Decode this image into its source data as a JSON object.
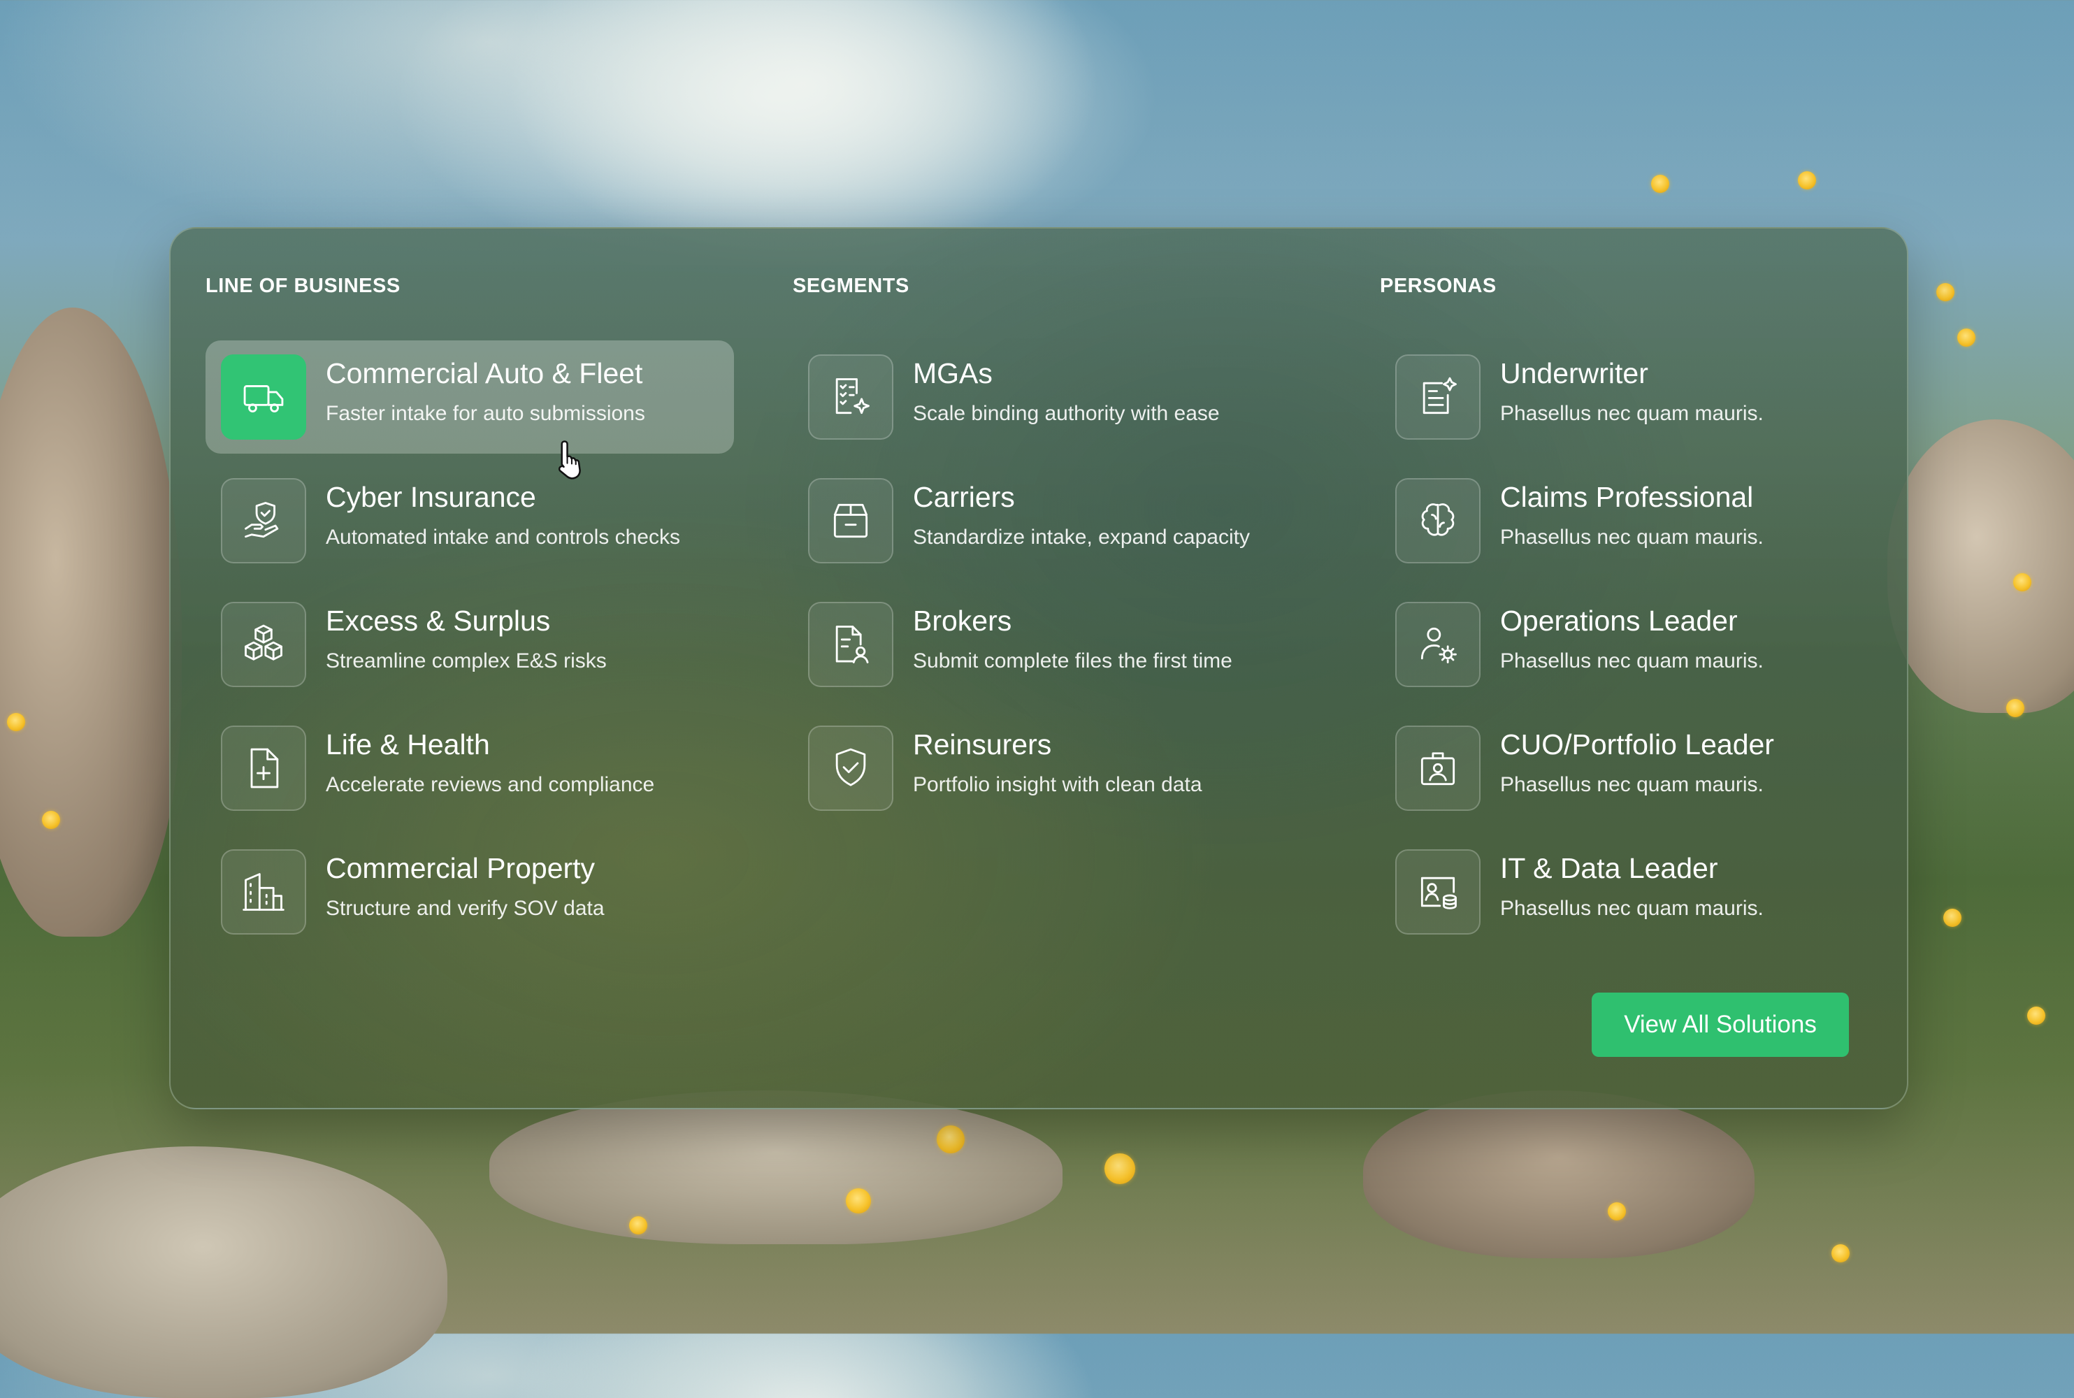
{
  "columns": [
    {
      "heading": "LINE OF BUSINESS",
      "items": [
        {
          "title": "Commercial Auto & Fleet",
          "subtitle": "Faster intake for auto submissions",
          "icon": "truck-icon",
          "active": true
        },
        {
          "title": "Cyber Insurance",
          "subtitle": "Automated intake and controls checks",
          "icon": "hand-shield-icon"
        },
        {
          "title": "Excess & Surplus",
          "subtitle": "Streamline complex E&S risks",
          "icon": "boxes-icon"
        },
        {
          "title": "Life & Health",
          "subtitle": "Accelerate reviews and compliance",
          "icon": "medical-file-icon"
        },
        {
          "title": "Commercial Property",
          "subtitle": "Structure and verify SOV data",
          "icon": "buildings-icon"
        }
      ]
    },
    {
      "heading": "SEGMENTS",
      "items": [
        {
          "title": "MGAs",
          "subtitle": "Scale binding authority with ease",
          "icon": "checklist-sparkle-icon"
        },
        {
          "title": "Carriers",
          "subtitle": "Standardize intake, expand capacity",
          "icon": "archive-box-icon"
        },
        {
          "title": "Brokers",
          "subtitle": "Submit complete files the first time",
          "icon": "document-user-icon"
        },
        {
          "title": "Reinsurers",
          "subtitle": "Portfolio insight with clean data",
          "icon": "shield-check-icon"
        }
      ]
    },
    {
      "heading": "PERSONAS",
      "items": [
        {
          "title": "Underwriter",
          "subtitle": "Phasellus nec quam mauris.",
          "icon": "document-sparkle-icon"
        },
        {
          "title": "Claims Professional",
          "subtitle": "Phasellus nec quam mauris.",
          "icon": "brain-icon"
        },
        {
          "title": "Operations Leader",
          "subtitle": "Phasellus nec quam mauris.",
          "icon": "user-gear-icon"
        },
        {
          "title": "CUO/Portfolio Leader",
          "subtitle": "Phasellus nec quam mauris.",
          "icon": "id-badge-icon"
        },
        {
          "title": "IT & Data Leader",
          "subtitle": "Phasellus nec quam mauris.",
          "icon": "user-database-icon"
        }
      ]
    }
  ],
  "cta_label": "View All Solutions",
  "colors": {
    "accent": "#31c474",
    "text": "#ffffff"
  }
}
